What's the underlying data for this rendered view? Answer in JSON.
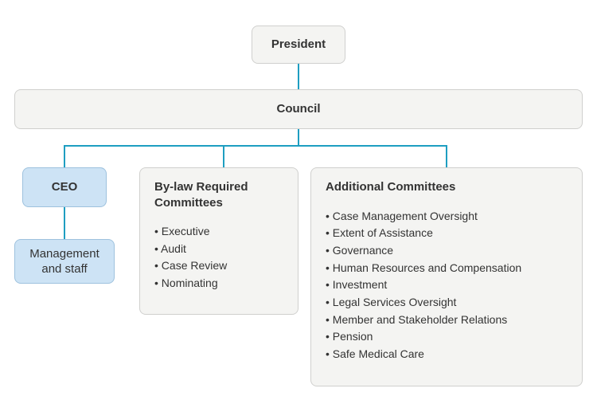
{
  "president": {
    "label": "President"
  },
  "council": {
    "label": "Council"
  },
  "ceo": {
    "label": "CEO"
  },
  "mgmt": {
    "label": "Management\nand staff"
  },
  "bylaw": {
    "title": "By-law Required Committees",
    "items": [
      "Executive",
      "Audit",
      "Case Review",
      "Nominating"
    ]
  },
  "additional": {
    "title": "Additional Committees",
    "items": [
      "Case Management Oversight",
      "Extent of Assistance",
      "Governance",
      "Human Resources and Compensation",
      "Investment",
      "Legal Services Oversight",
      "Member and Stakeholder Relations",
      "Pension",
      "Safe Medical Care"
    ]
  }
}
